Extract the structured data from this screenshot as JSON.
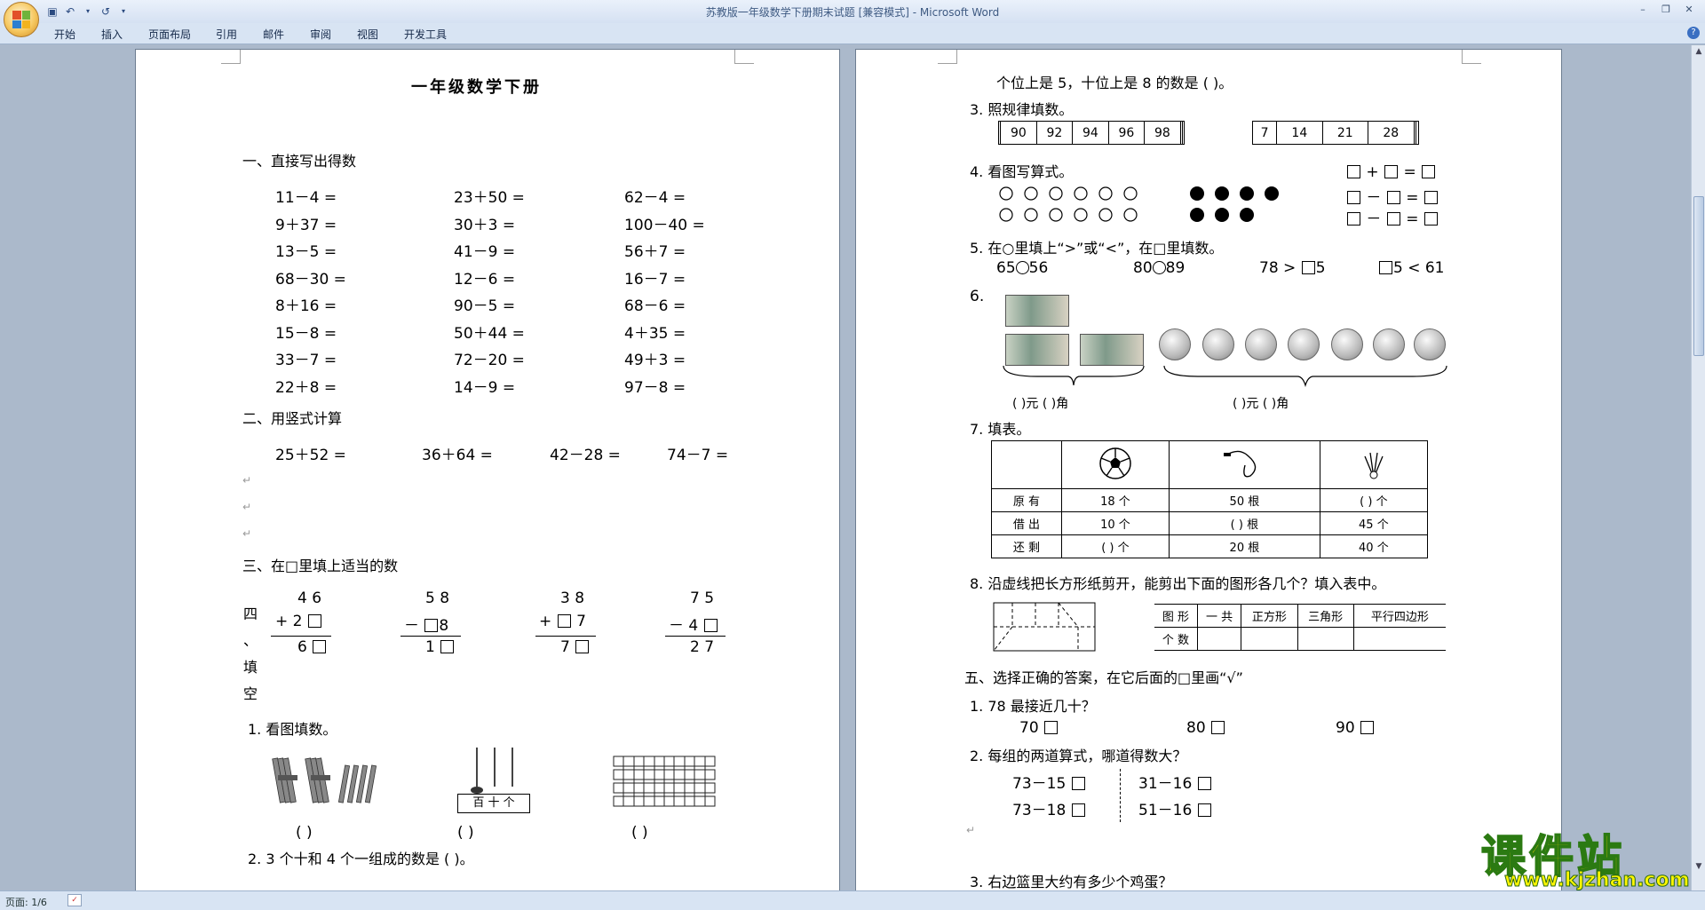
{
  "window": {
    "title": "苏教版一年级数学下册期末试题 [兼容模式] - Microsoft Word"
  },
  "ribbon": {
    "tabs": [
      "开始",
      "插入",
      "页面布局",
      "引用",
      "邮件",
      "审阅",
      "视图",
      "开发工具"
    ]
  },
  "status": {
    "page": "页面: 1/6"
  },
  "watermark": {
    "main": "课件站",
    "url": "www.kjzhan.com"
  },
  "colors": {
    "accent": "#ffd800",
    "logo_stroke": "#2b7a12"
  },
  "page1": {
    "title": "一年级数学下册",
    "s1": "一、直接写出得数",
    "arith": [
      [
        "11－4 =",
        "23＋50 =",
        "62－4 ="
      ],
      [
        "9＋37 =",
        "30＋3 =",
        "100－40 ="
      ],
      [
        "13－5 =",
        "41－9 =",
        "56＋7 ="
      ],
      [
        "68－30 =",
        "12－6 =",
        "16－7 ="
      ],
      [
        "8＋16 =",
        "90－5 =",
        "68－6 ="
      ],
      [
        "15－8 =",
        "50＋44 =",
        "4＋35 ="
      ],
      [
        "33－7 =",
        "72－20 =",
        "49＋3 ="
      ],
      [
        "22＋8 =",
        "14－9 =",
        "97－8 ="
      ]
    ],
    "s2": "二、用竖式计算",
    "vert": [
      "25＋52 =",
      "36＋64 =",
      "42－28 =",
      "74－7 ="
    ],
    "s3": "三、在□里填上适当的数",
    "s4": [
      "四",
      "、",
      "填",
      "空"
    ],
    "puzzles": [
      [
        "4 6",
        "+ 2",
        "6"
      ],
      [
        "5 8",
        "－",
        "8",
        "1"
      ],
      [
        "3 8",
        "+",
        "7",
        "7"
      ],
      [
        "7 5",
        "－ 4",
        "2 7"
      ]
    ],
    "q1": "1.  看图填数。",
    "q1_abacus": "百 十 个",
    "q1_blanks": [
      "(          )",
      "(          )",
      "(          )"
    ],
    "q2": "2.  3 个十和 4 个一组成的数是 (            )。"
  },
  "page2": {
    "q2b": "个位上是 5，十位上是 8 的数是 (            )。",
    "q3": "3.  照规律填数。",
    "seq1": [
      "",
      "90",
      "92",
      "94",
      "96",
      "98",
      "",
      ""
    ],
    "seq2": [
      "7",
      "14",
      "21",
      "28",
      "",
      ""
    ],
    "q4": "4.  看图写算式。",
    "q4_ops": [
      [
        "+",
        "="
      ],
      [
        "－",
        "="
      ],
      [
        "－",
        "="
      ]
    ],
    "q5": "5.  在○里填上“>”或“<”，在□里填数。",
    "q5_items": [
      "65",
      "56",
      "80",
      "89",
      "78 >",
      "5",
      "5 < 61"
    ],
    "q6": "6.",
    "q6_blanks": [
      "(      )元 (      )角",
      "(      )元 (      )角"
    ],
    "q7": "7.  填表。",
    "table7": {
      "rows": [
        [
          "原  有",
          "18 个",
          "50 根",
          "(      ) 个"
        ],
        [
          "借  出",
          "10 个",
          "(      ) 根",
          "45 个"
        ],
        [
          "还  剩",
          "(      ) 个",
          "20 根",
          "40 个"
        ]
      ]
    },
    "q8": "8.  沿虚线把长方形纸剪开，能剪出下面的图形各几个？填入表中。",
    "table8": {
      "header": [
        "图  形",
        "一  共",
        "正方形",
        "三角形",
        "平行四边形"
      ],
      "row": [
        "个  数",
        "",
        "",
        "",
        ""
      ]
    },
    "s5": "五、选择正确的答案，在它后面的□里画“√”",
    "s5q1": "1.  78 最接近几十？",
    "s5q1_opts": [
      "70",
      "80",
      "90"
    ],
    "s5q2": "2.  每组的两道算式，哪道得数大？",
    "s5q2_items": [
      "73－15",
      "31－16",
      "73－18",
      "51－16"
    ],
    "s5q3": "3. 右边篮里大约有多少个鸡蛋？"
  }
}
